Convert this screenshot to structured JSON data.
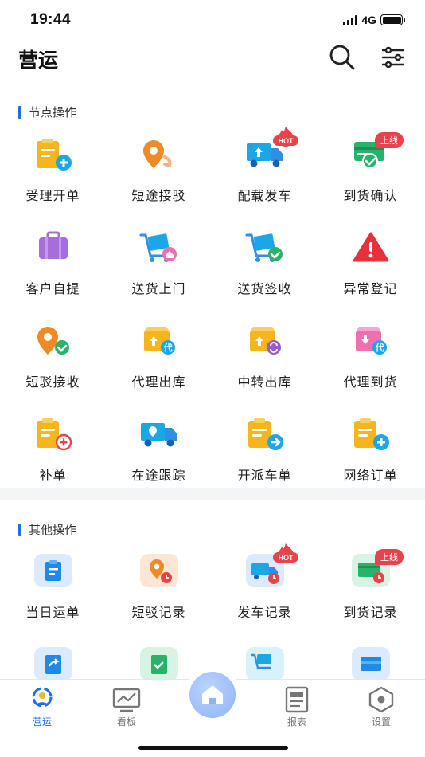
{
  "status": {
    "time": "19:44",
    "network": "4G"
  },
  "header": {
    "title": "营运"
  },
  "sections": {
    "node_ops": {
      "title": "节点操作",
      "items": [
        {
          "label": "受理开单"
        },
        {
          "label": "短途接驳"
        },
        {
          "label": "配载发车",
          "badge": "HOT"
        },
        {
          "label": "到货确认",
          "badge": "上线"
        },
        {
          "label": "客户自提"
        },
        {
          "label": "送货上门"
        },
        {
          "label": "送货签收"
        },
        {
          "label": "异常登记"
        },
        {
          "label": "短驳接收"
        },
        {
          "label": "代理出库"
        },
        {
          "label": "中转出库"
        },
        {
          "label": "代理到货"
        },
        {
          "label": "补单"
        },
        {
          "label": "在途跟踪"
        },
        {
          "label": "开派车单"
        },
        {
          "label": "网络订单"
        }
      ]
    },
    "other_ops": {
      "title": "其他操作",
      "items": [
        {
          "label": "当日运单"
        },
        {
          "label": "短驳记录"
        },
        {
          "label": "发车记录",
          "badge": "HOT"
        },
        {
          "label": "到货记录",
          "badge": "上线"
        }
      ]
    }
  },
  "tabs": [
    {
      "label": "营运",
      "icon": "operations-icon",
      "active": true
    },
    {
      "label": "看板",
      "icon": "dashboard-icon"
    },
    {
      "label": "",
      "icon": "home-icon"
    },
    {
      "label": "报表",
      "icon": "report-icon"
    },
    {
      "label": "设置",
      "icon": "settings-icon"
    }
  ],
  "colors": {
    "accent": "#1e6ee8",
    "hot": "#e8424c",
    "icon_yellow": "#f6b51d",
    "icon_blue": "#1aa7e8",
    "icon_green": "#27b36a",
    "icon_orange": "#f08a24",
    "icon_purple": "#9b59d0",
    "icon_pink": "#f06fb0"
  }
}
